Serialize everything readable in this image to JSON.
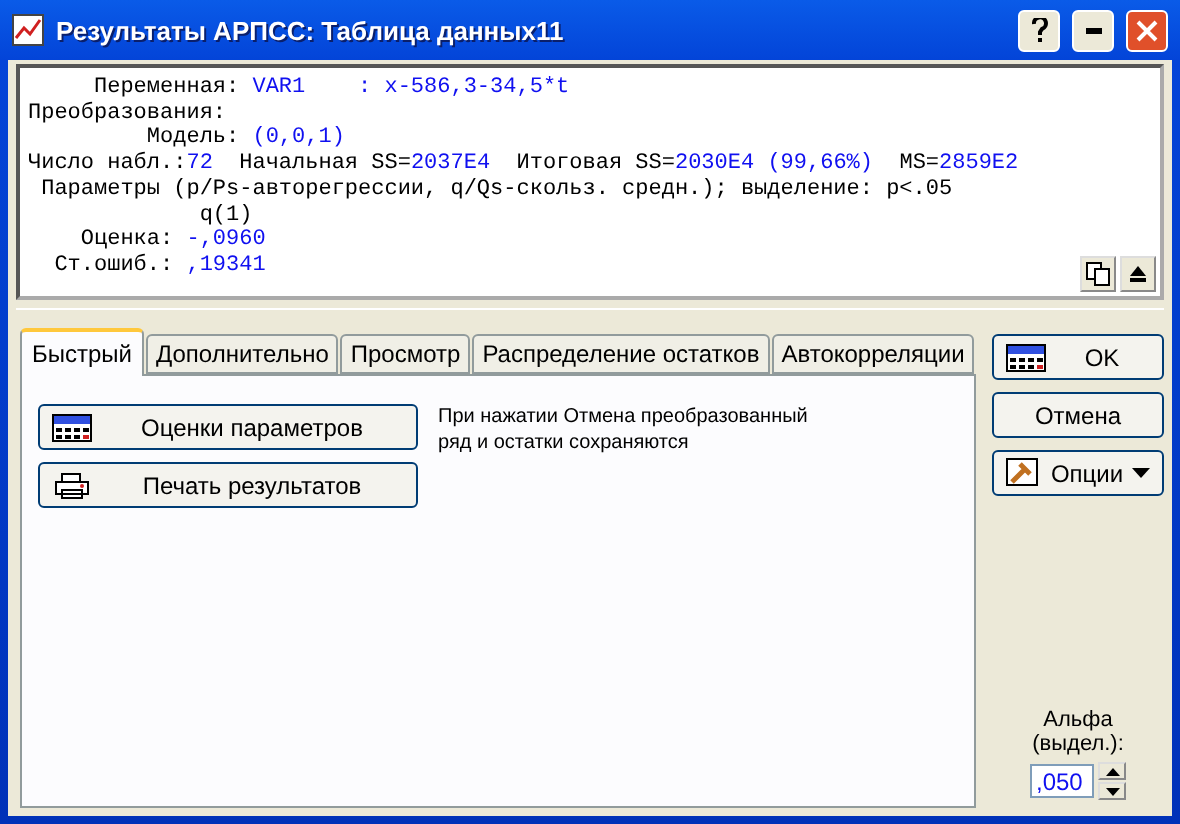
{
  "window": {
    "title": "Результаты АРПСС: Таблица данных11"
  },
  "output": {
    "lines": [
      [
        {
          "kind": "label",
          "text": "     Переменная: "
        },
        {
          "kind": "value",
          "text": "VAR1    : x-586,3-34,5*t"
        }
      ],
      [
        {
          "kind": "label",
          "text": "Преобразования:"
        }
      ],
      [
        {
          "kind": "label",
          "text": "         Модель: "
        },
        {
          "kind": "value",
          "text": "(0,0,1)"
        }
      ],
      [
        {
          "kind": "label",
          "text": "Число набл.:"
        },
        {
          "kind": "value",
          "text": "72"
        },
        {
          "kind": "label",
          "text": "  Начальная SS="
        },
        {
          "kind": "value",
          "text": "2037E4"
        },
        {
          "kind": "label",
          "text": "  Итоговая SS="
        },
        {
          "kind": "value",
          "text": "2030E4 (99,66%)"
        },
        {
          "kind": "label",
          "text": "  MS="
        },
        {
          "kind": "value",
          "text": "2859E2"
        }
      ],
      [
        {
          "kind": "label",
          "text": " Параметры (p/Ps-авторегрессии, q/Qs-скольз. средн.); выделение: p<.05"
        }
      ],
      [
        {
          "kind": "label",
          "text": "             q(1)"
        }
      ],
      [
        {
          "kind": "label",
          "text": "    Оценка: "
        },
        {
          "kind": "value",
          "text": "-,0960"
        }
      ],
      [
        {
          "kind": "label",
          "text": "  Ст.ошиб.: "
        },
        {
          "kind": "value",
          "text": ",19341"
        }
      ]
    ]
  },
  "tabs": [
    {
      "label": "Быстрый",
      "selected": true
    },
    {
      "label": "Дополнительно",
      "selected": false
    },
    {
      "label": "Просмотр",
      "selected": false
    },
    {
      "label": "Распределение остатков",
      "selected": false
    },
    {
      "label": "Автокорреляции",
      "selected": false
    }
  ],
  "actions": [
    {
      "label": "Оценки параметров",
      "kind": "summary"
    },
    {
      "label": "Печать результатов",
      "kind": "print"
    }
  ],
  "note": "При нажатии Отмена преобразованный ряд и остатки сохраняются",
  "side_buttons": [
    {
      "label": "OK",
      "kind": "ok"
    },
    {
      "label": "Отмена",
      "kind": "plain"
    },
    {
      "label": "Опции",
      "kind": "menu"
    }
  ],
  "alpha": {
    "label": "Альфа (выдел.):",
    "value": ",050"
  }
}
